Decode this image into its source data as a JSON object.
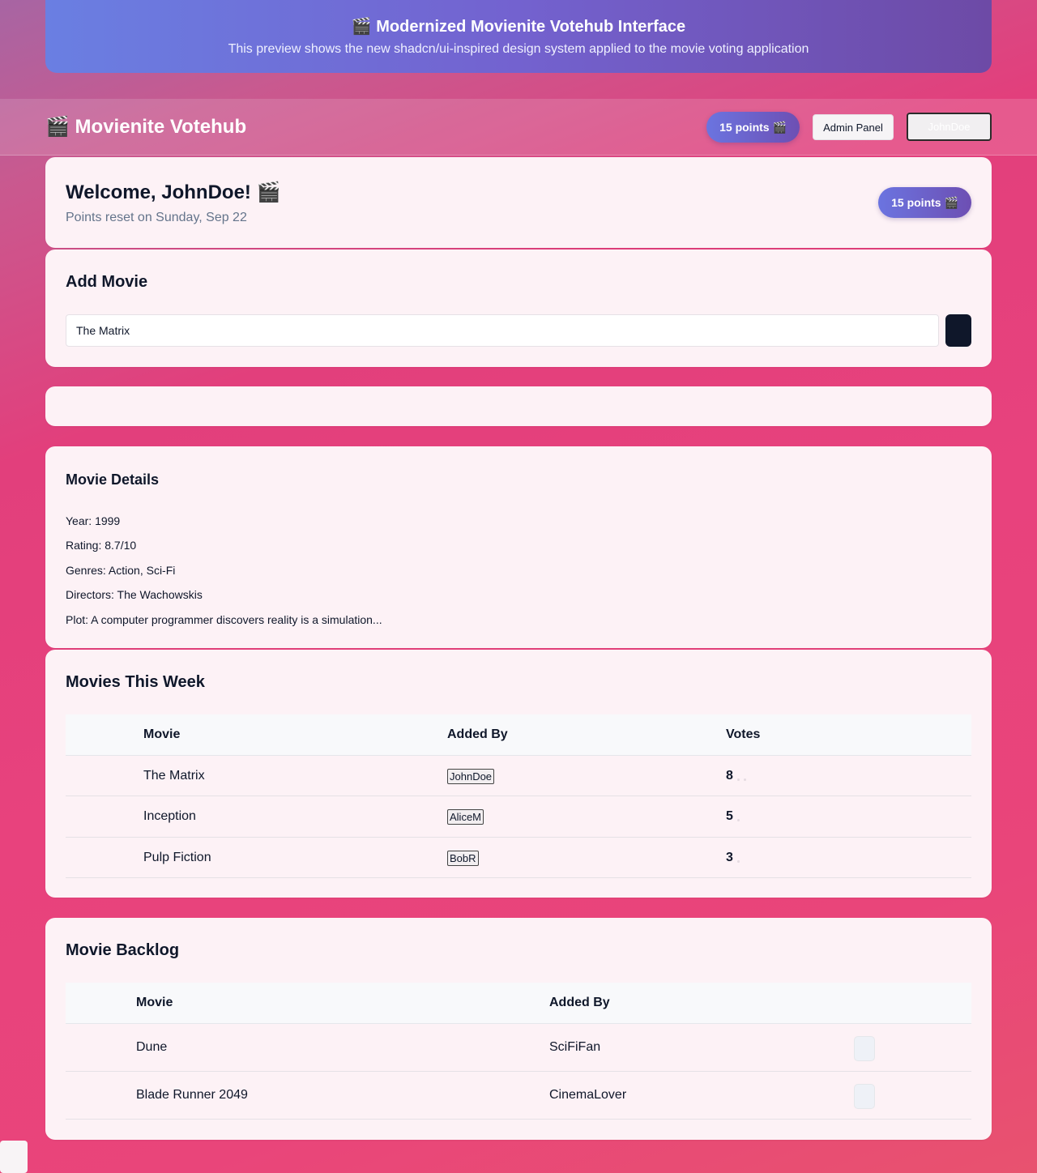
{
  "banner": {
    "title": "🎬 Modernized Movienite Votehub Interface",
    "subtitle": "This preview shows the new shadcn/ui-inspired design system applied to the movie voting application"
  },
  "topbar": {
    "app_title": "🎬 Movienite Votehub",
    "points": "15 points 🎬",
    "admin_label": "Admin Panel",
    "user_label": "JohnDoe"
  },
  "welcome": {
    "title": "Welcome, JohnDoe! 🎬",
    "subtitle": "Points reset on Sunday, Sep 22",
    "points": "15 points 🎬"
  },
  "add_movie": {
    "title": "Add Movie",
    "input_value": "The Matrix"
  },
  "details": {
    "title": "Movie Details",
    "year": "Year: 1999",
    "rating": "Rating: 8.7/10",
    "genres": "Genres: Action, Sci-Fi",
    "directors": "Directors: The Wachowskis",
    "plot": "Plot: A computer programmer discovers reality is a simulation..."
  },
  "week": {
    "title": "Movies This Week",
    "headers": {
      "movie": "Movie",
      "added_by": "Added By",
      "votes": "Votes"
    },
    "rows": [
      {
        "movie": "The Matrix",
        "added_by": "JohnDoe",
        "votes": "8"
      },
      {
        "movie": "Inception",
        "added_by": "AliceM",
        "votes": "5"
      },
      {
        "movie": "Pulp Fiction",
        "added_by": "BobR",
        "votes": "3"
      }
    ]
  },
  "backlog": {
    "title": "Movie Backlog",
    "headers": {
      "movie": "Movie",
      "added_by": "Added By"
    },
    "rows": [
      {
        "movie": "Dune",
        "added_by": "SciFiFan"
      },
      {
        "movie": "Blade Runner 2049",
        "added_by": "CinemaLover"
      }
    ]
  }
}
